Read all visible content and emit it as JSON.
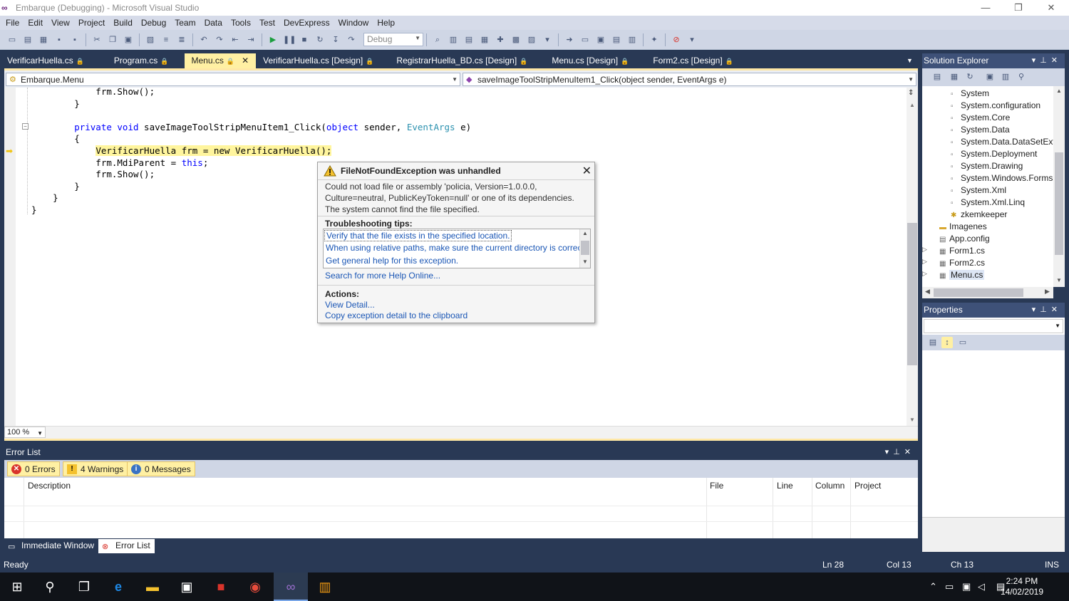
{
  "window": {
    "title": "Embarque (Debugging) - Microsoft Visual Studio",
    "minimize": "—",
    "restore": "❐",
    "close": "✕"
  },
  "menu": [
    "File",
    "Edit",
    "View",
    "Project",
    "Build",
    "Debug",
    "Team",
    "Data",
    "Tools",
    "Test",
    "DevExpress",
    "Window",
    "Help"
  ],
  "toolbar": {
    "config_combo": "Debug"
  },
  "doc_tabs": [
    {
      "label": "VerificarHuella.cs"
    },
    {
      "label": "Program.cs"
    },
    {
      "label": "Menu.cs",
      "active": true
    },
    {
      "label": "VerificarHuella.cs [Design]"
    },
    {
      "label": "RegistrarHuella_BD.cs [Design]"
    },
    {
      "label": "Menu.cs [Design]"
    },
    {
      "label": "Form2.cs [Design]"
    }
  ],
  "nav": {
    "class_combo": "Embarque.Menu",
    "member_combo": "saveImageToolStripMenuItem1_Click(object sender, EventArgs e)"
  },
  "code": {
    "line1": "            frm.Show();",
    "line2": "        }",
    "line3_a": "        private void ",
    "line3_b": "saveImageToolStripMenuItem1_Click(",
    "line3_c": "object",
    "line3_d": " sender, ",
    "line3_e": "EventArgs",
    "line3_f": " e)",
    "line4": "        {",
    "line5_hl": "VerificarHuella frm = new VerificarHuella();",
    "line5_indent": "            ",
    "line6_a": "            frm.MdiParent = ",
    "line6_b": "this",
    "line6_c": ";",
    "line7": "            frm.Show();",
    "line8": "        }",
    "line9": "    }",
    "line10": "}"
  },
  "zoom": "100 %",
  "exception": {
    "title": "FileNotFoundException was unhandled",
    "message": "Could not load file or assembly 'policia, Version=1.0.0.0, Culture=neutral, PublicKeyToken=null' or one of its dependencies. The system cannot find the file specified.",
    "tips_header": "Troubleshooting tips:",
    "tips": [
      "Verify that the file exists in the specified location.",
      "When using relative paths, make sure the current directory is correct.",
      "Get general help for this exception."
    ],
    "search_link": "Search for more Help Online...",
    "actions_header": "Actions:",
    "actions": [
      "View Detail...",
      "Copy exception detail to the clipboard"
    ]
  },
  "solution_explorer": {
    "title": "Solution Explorer",
    "refs": [
      "System",
      "System.configuration",
      "System.Core",
      "System.Data",
      "System.Data.DataSetExte",
      "System.Deployment",
      "System.Drawing",
      "System.Windows.Forms",
      "System.Xml",
      "System.Xml.Linq",
      "zkemkeeper"
    ],
    "items": [
      {
        "label": "Imagenes",
        "icon": "folder-icon"
      },
      {
        "label": "App.config",
        "icon": "config-file-icon"
      },
      {
        "label": "Form1.cs",
        "icon": "form-icon",
        "expandable": true
      },
      {
        "label": "Form2.cs",
        "icon": "form-icon",
        "expandable": true
      },
      {
        "label": "Menu.cs",
        "icon": "form-icon",
        "expandable": true,
        "selected": true
      }
    ]
  },
  "properties": {
    "title": "Properties"
  },
  "error_list": {
    "title": "Error List",
    "errors": "0 Errors",
    "warnings": "4 Warnings",
    "messages": "0 Messages",
    "columns": {
      "description": "Description",
      "file": "File",
      "line": "Line",
      "column": "Column",
      "project": "Project"
    }
  },
  "bottom_tabs": {
    "immediate": "Immediate Window",
    "error_list": "Error List"
  },
  "status": {
    "state": "Ready",
    "ln": "Ln 28",
    "col": "Col 13",
    "ch": "Ch 13",
    "ins": "INS"
  },
  "clock": {
    "time": "2:24 PM",
    "date": "14/02/2019"
  },
  "colors": {
    "chrome": "#293955",
    "accent": "#fff0a3",
    "link": "#1a56b5",
    "keyword": "#0000ff",
    "type": "#2b91af"
  }
}
